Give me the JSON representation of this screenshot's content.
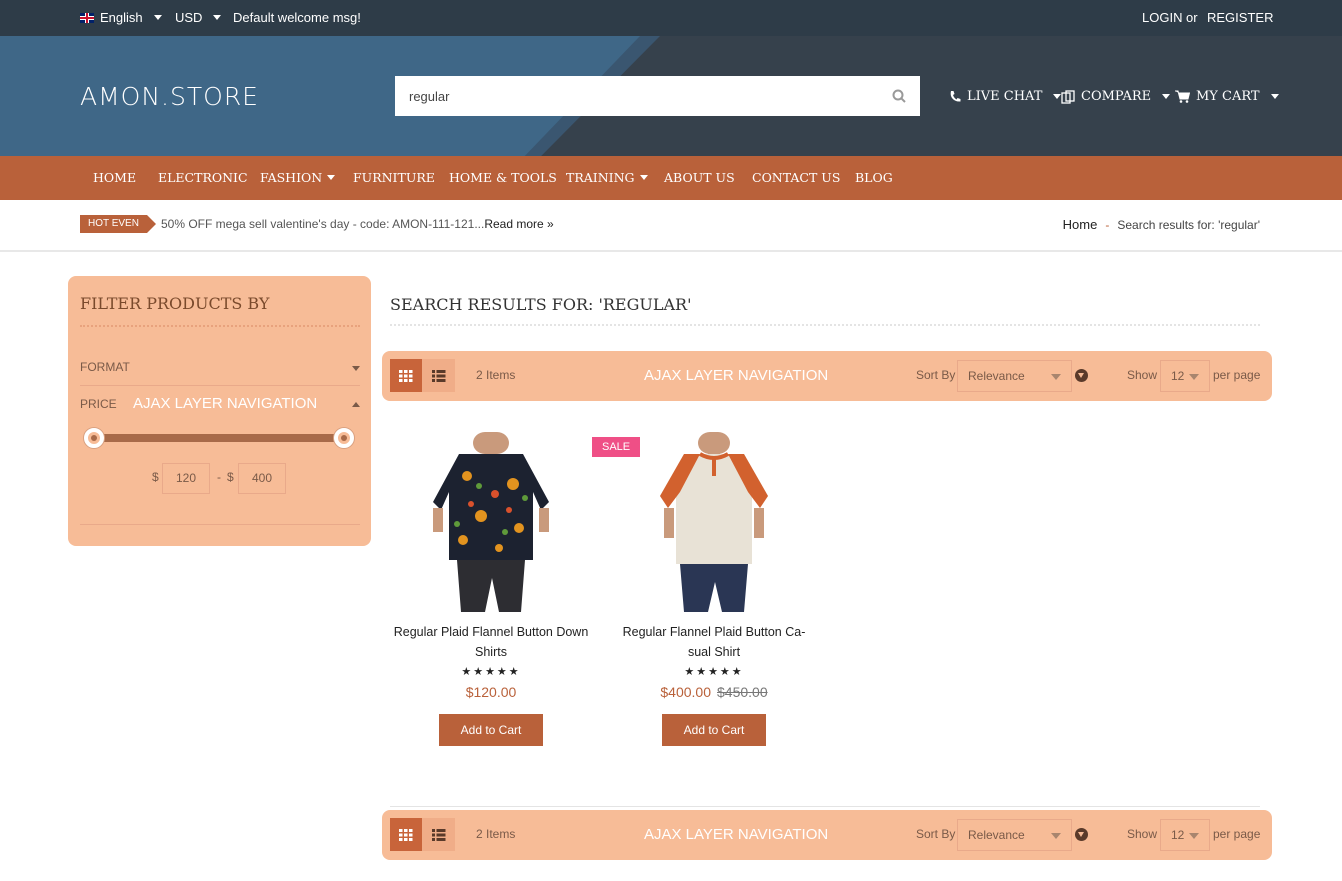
{
  "topbar": {
    "language": "English",
    "currency": "USD",
    "welcome": "Default welcome msg!",
    "login": "LOGIN",
    "or": "or",
    "register": "REGISTER"
  },
  "header": {
    "logo": "AMON.STORE",
    "search_value": "regular",
    "live_chat": "LIVE CHAT",
    "compare": "COMPARE",
    "my_cart": "MY CART"
  },
  "nav": [
    "HOME",
    "ELECTRONIC",
    "FASHION",
    "FURNITURE",
    "HOME & TOOLS",
    "TRAINING",
    "ABOUT US",
    "CONTACT US",
    "BLOG"
  ],
  "strip": {
    "hot": "HOT EVEN",
    "promo": "50% OFF mega sell valentine's day - code: AMON-111-121...",
    "read_more": "Read more »",
    "breadcrumb_home": "Home",
    "breadcrumb_sep": "-",
    "breadcrumb_current": "Search results for: 'regular'"
  },
  "sidebar": {
    "title": "FILTER PRODUCTS BY",
    "format": "FORMAT",
    "price": "PRICE",
    "ajax": "AJAX LAYER NAVIGATION",
    "currency": "$",
    "dash": "-",
    "min": "120",
    "max": "400"
  },
  "main": {
    "title": "SEARCH RESULTS FOR: 'REGULAR'",
    "toolbar": {
      "count": "2 Items",
      "ajax": "AJAX LAYER NAVIGATION",
      "sort_by": "Sort By",
      "sort_value": "Relevance",
      "show": "Show",
      "show_value": "12",
      "per_page": "per page"
    }
  },
  "products": [
    {
      "name": "Regular Plaid Flannel Button Down Shirts",
      "stars": "★★★★★",
      "price": "$120.00",
      "old_price": "",
      "sale": "",
      "cart": "Add to Cart"
    },
    {
      "name": "Regular Flannel Plaid Button Ca-sual Shirt",
      "stars": "★★★★★",
      "price": "$400.00",
      "old_price": "$450.00",
      "sale": "SALE",
      "cart": "Add to Cart"
    }
  ],
  "colors": {
    "accent": "#b9613a",
    "peach": "#f7bc97",
    "dark": "#2e3c48",
    "sale": "#ef4f86"
  }
}
